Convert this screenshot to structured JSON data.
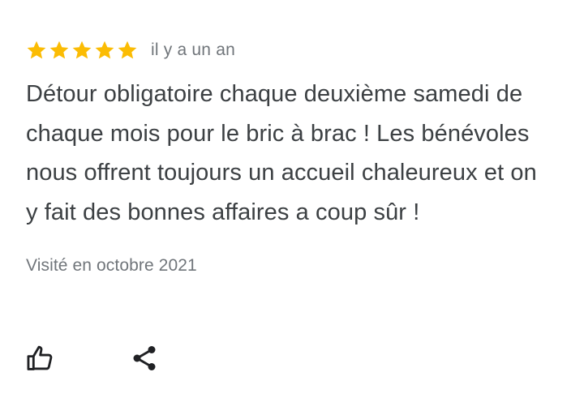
{
  "review": {
    "rating": 5,
    "rating_max": 5,
    "star_color": "#fbbc04",
    "stars": [
      "star-icon",
      "star-icon",
      "star-icon",
      "star-icon",
      "star-icon"
    ],
    "time_ago": "il y a un an",
    "text": "Détour obligatoire chaque deuxième samedi de chaque mois pour le bric à brac ! Les bénévoles nous offrent toujours un accueil chaleureux et on y fait des bonnes affaires a coup sûr !",
    "visited": "Visité en octobre 2021"
  },
  "actions": {
    "like_icon": "thumb-up-icon",
    "share_icon": "share-icon"
  }
}
